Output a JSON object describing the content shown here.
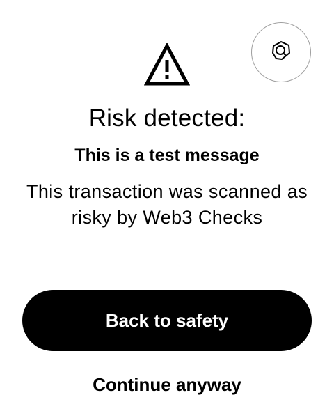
{
  "header": {
    "brand_icon": "web3-checks-logo-icon",
    "warning_icon": "warning-triangle-icon"
  },
  "alert": {
    "title": "Risk detected:",
    "subtitle": "This is a test message",
    "description": "This transaction was scanned as risky by Web3 Checks"
  },
  "actions": {
    "primary_label": "Back to safety",
    "secondary_label": "Continue anyway"
  },
  "colors": {
    "primary_button_bg": "#000000",
    "primary_button_text": "#ffffff",
    "text": "#000000",
    "brand_button_border": "#9e9e9e"
  }
}
